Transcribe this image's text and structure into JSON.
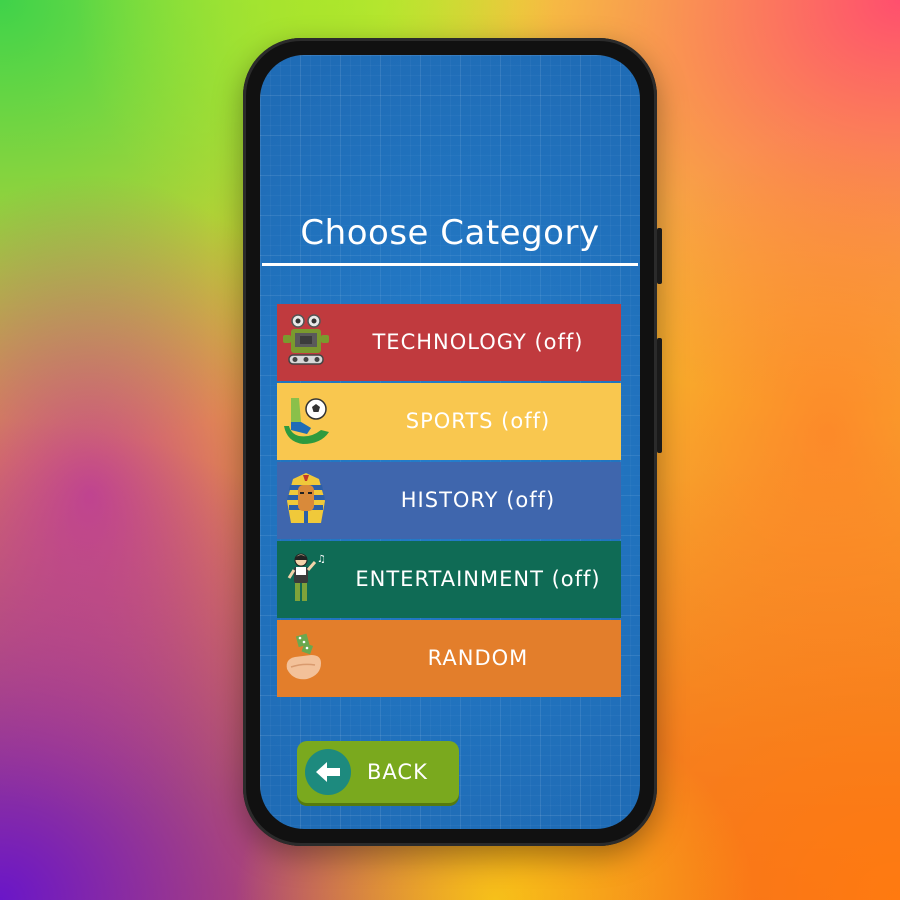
{
  "screen": {
    "title": "Choose Category"
  },
  "categories": [
    {
      "label": "TECHNOLOGY (off)",
      "color": "#c03a3e",
      "icon": "robot-icon"
    },
    {
      "label": "SPORTS (off)",
      "color": "#f9c74f",
      "icon": "soccer-icon"
    },
    {
      "label": "HISTORY (off)",
      "color": "#3f66ad",
      "icon": "pharaoh-icon"
    },
    {
      "label": "ENTERTAINMENT (off)",
      "color": "#0f6b55",
      "icon": "singer-icon"
    },
    {
      "label": "RANDOM",
      "color": "#e37e2b",
      "icon": "dice-hand-icon"
    }
  ],
  "back_button": {
    "label": "BACK",
    "color": "#7aa91e",
    "icon": "arrow-left-icon"
  }
}
